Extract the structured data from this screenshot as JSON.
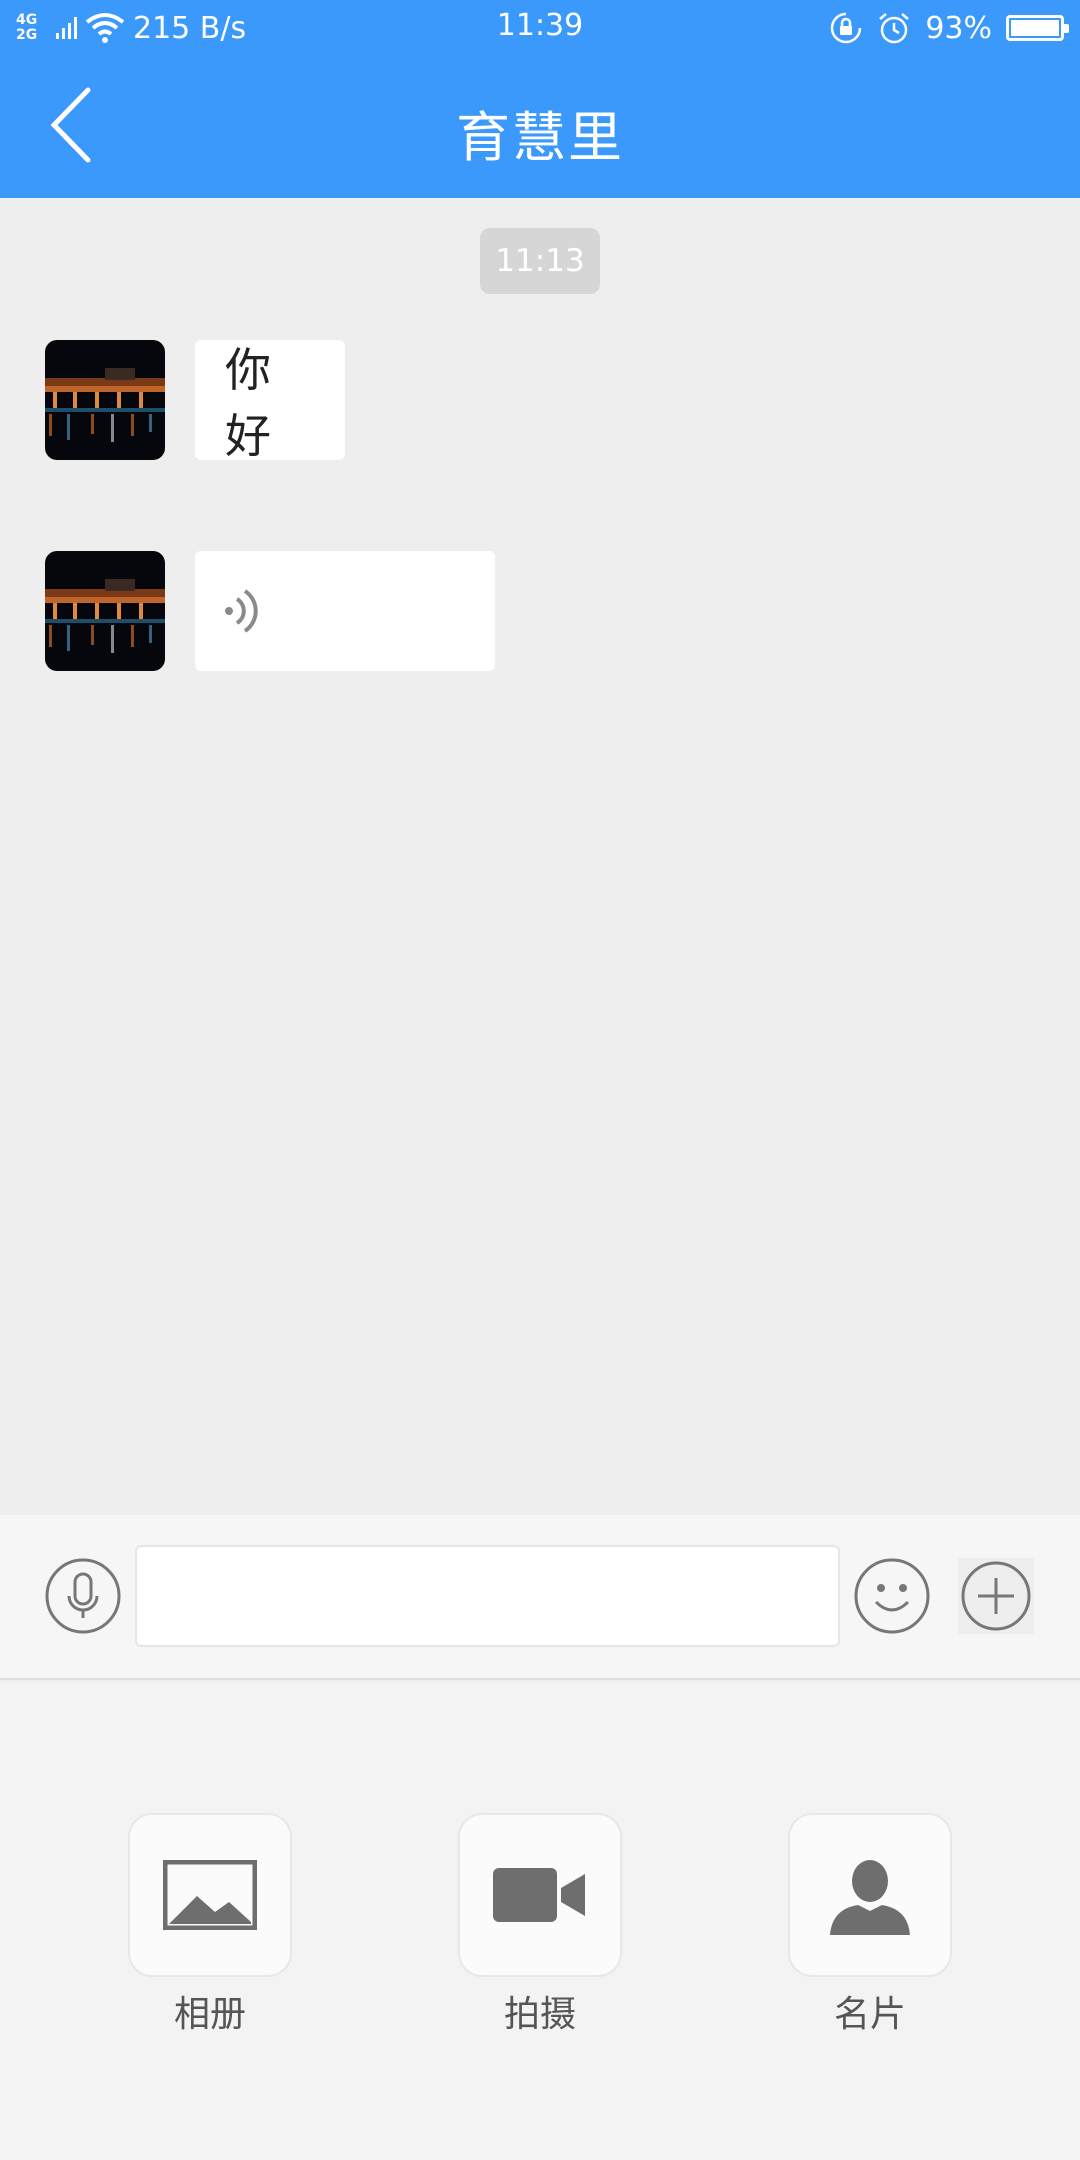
{
  "status_bar": {
    "network_top": "4G",
    "network_bottom": "2G",
    "speed": "215 B/s",
    "time": "11:39",
    "battery_pct": "93%",
    "battery_level": 0.93
  },
  "header": {
    "title": "育慧里"
  },
  "chat": {
    "timestamp": "11:13",
    "messages": [
      {
        "type": "text",
        "text": "你好"
      },
      {
        "type": "voice",
        "text": ""
      }
    ]
  },
  "input_bar": {
    "placeholder": "",
    "value": ""
  },
  "panel": {
    "items": [
      {
        "label": "相册",
        "icon": "image-icon"
      },
      {
        "label": "拍摄",
        "icon": "video-camera-icon"
      },
      {
        "label": "名片",
        "icon": "person-icon"
      }
    ]
  },
  "colors": {
    "brand": "#3a99fb",
    "chat_background": "#eeeeee",
    "bubble": "#ffffff",
    "icon_gray": "#666666"
  }
}
